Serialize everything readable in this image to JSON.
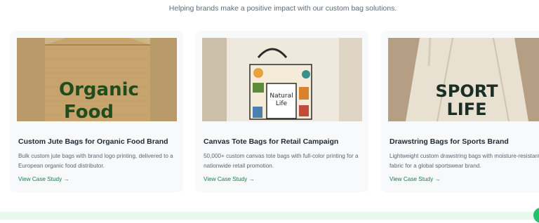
{
  "intro": {
    "subtitle": "Helping brands make a positive impact with our custom bag solutions."
  },
  "cards": [
    {
      "image_text_1": "Organic",
      "image_text_2": "Food",
      "title": "Custom Jute Bags for Organic Food Brand",
      "description": "Bulk custom jute bags with brand logo printing, delivered to a European organic food distributor.",
      "link": "View Case Study →"
    },
    {
      "image_text_1": "Natural",
      "image_text_2": "Life",
      "title": "Canvas Tote Bags for Retail Campaign",
      "description": "50,000+ custom canvas tote bags with full-color printing for a nationwide retail promotion.",
      "link": "View Case Study →"
    },
    {
      "image_text_1": "SPORT",
      "image_text_2": "LIFE",
      "title": "Drawstring Bags for Sports Brand",
      "description": "Lightweight custom drawstring bags with moisture-resistant fabric for a global sportswear brand.",
      "link": "View Case Study →"
    }
  ],
  "colors": {
    "accent": "#1f7a45",
    "card_bg": "#f7f9fb",
    "band": "#e9f8ef",
    "fab": "#23c16b"
  }
}
